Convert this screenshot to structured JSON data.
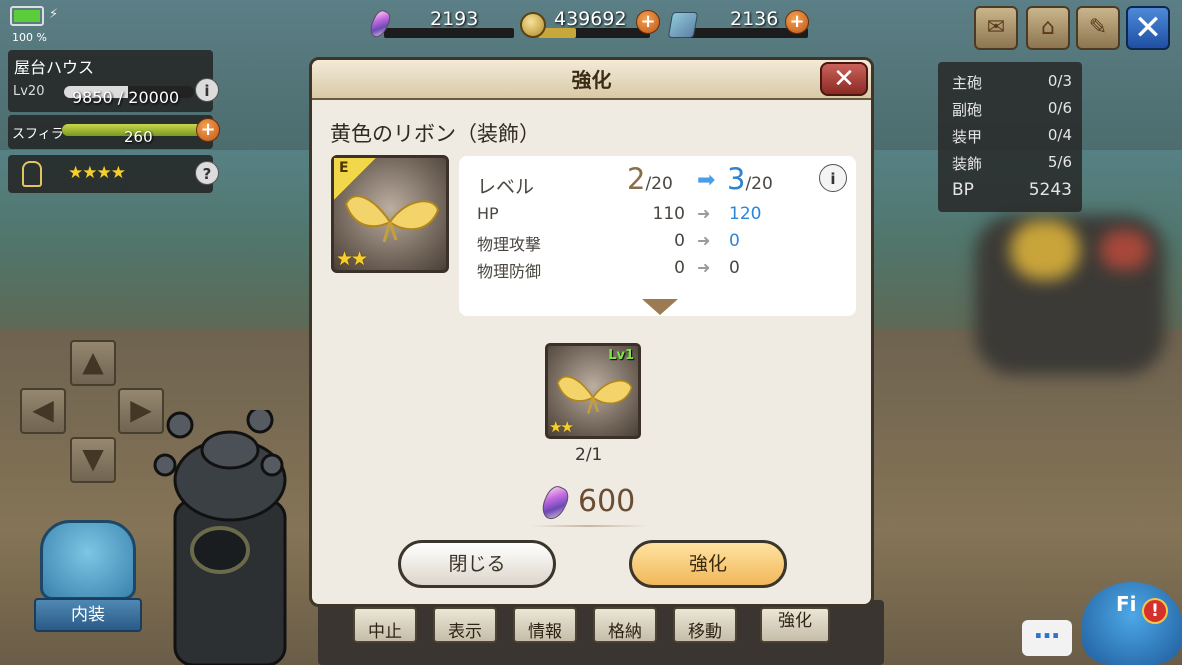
{
  "status": {
    "battery_pct": "100 %"
  },
  "resources": {
    "crystal": "2193",
    "gold": "439692",
    "material": "2136"
  },
  "house": {
    "name": "屋台ハウス",
    "level": "Lv20",
    "exp_text": "9850 / 20000",
    "exp_fraction": 0.4925,
    "spira_label": "スフィラ",
    "spira_value": "260",
    "rank_stars": "★★★★"
  },
  "slots_panel": {
    "rows": [
      {
        "label": "主砲",
        "value": "0/3"
      },
      {
        "label": "副砲",
        "value": "0/6"
      },
      {
        "label": "装甲",
        "value": "0/4"
      },
      {
        "label": "装飾",
        "value": "5/6"
      },
      {
        "label": "BP",
        "value": "5243"
      }
    ]
  },
  "left_button": {
    "label": "内装"
  },
  "action_bar": [
    "中止",
    "表示",
    "情報",
    "格納",
    "移動",
    "強化"
  ],
  "dialog": {
    "title": "強化",
    "item_name": "黄色のリボン（装飾）",
    "equipped_badge": "E",
    "item_stars": "★★",
    "level_label": "レベル",
    "level_current": "2",
    "level_max": "/20",
    "level_next": "3",
    "level_next_max": "/20",
    "stats": [
      {
        "label": "HP",
        "current": "110",
        "next": "120",
        "changed": true
      },
      {
        "label": "物理攻撃",
        "current": "0",
        "next": "0",
        "changed": true
      },
      {
        "label": "物理防御",
        "current": "0",
        "next": "0",
        "changed": false
      }
    ],
    "material": {
      "level": "Lv1",
      "stars": "★★",
      "count": "2/1"
    },
    "cost": "600",
    "close_label": "閉じる",
    "enhance_label": "強化"
  },
  "npc": {
    "label": "Fi"
  },
  "colors": {
    "accent_blue": "#2f83d0",
    "level_brown": "#8b6e49",
    "enhance_button": "#f1b75a"
  }
}
